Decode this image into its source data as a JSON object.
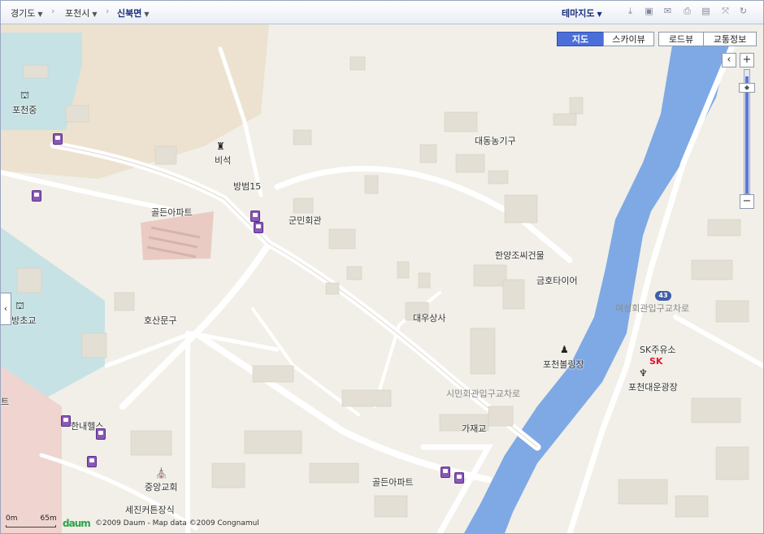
{
  "breadcrumb": [
    {
      "label": "경기도",
      "has_dropdown": true
    },
    {
      "label": "포천시",
      "has_dropdown": true
    },
    {
      "label": "신북면",
      "has_dropdown": true
    }
  ],
  "toolbar": {
    "theme_label": "테마지도",
    "icons": [
      "download-icon",
      "save-icon",
      "mail-icon",
      "print-icon",
      "ruler-icon",
      "fullscreen-icon",
      "refresh-icon"
    ]
  },
  "map_types": {
    "map": "지도",
    "skyview": "스카이뷰",
    "roadview": "로드뷰",
    "traffic": "교통정보",
    "active": "지도"
  },
  "zoom": {
    "plus": "+",
    "minus": "−",
    "back": "‹",
    "level_fraction": 0.95
  },
  "left_tab": "‹",
  "places": {
    "pocheon_middle": "포천중",
    "biseok": "비석",
    "bangbeom15": "방범15",
    "golden_apt1": "골든아파트",
    "gunmin_hall": "군민회관",
    "daedong": "대동농기구",
    "hanyang": "한양조씨건물",
    "geumho": "금호타이어",
    "daewoo": "대우상사",
    "hosan": "호산문구",
    "wangbang": "왕방초교",
    "pocheon_bowling": "포천볼링장",
    "sk_station": "SK주유소",
    "daeun_plaza": "포천대운광장",
    "gajae": "가재교",
    "golden_apt2": "골든아파트",
    "jungang_church": "중앙교회",
    "sejin": "세진커튼장식",
    "hanne": "한내헬스",
    "left_cut": "트"
  },
  "roads": {
    "simin_intersection": "시민회관입구교차로",
    "yeoseong_intersection": "여성회관입구교차로",
    "route_number": "43"
  },
  "sk_logo": "SK",
  "scale": {
    "start": "0m",
    "end": "65m"
  },
  "logo_text": "daum",
  "copyright": "©2009 Daum - Map data ©2009 Congnamul",
  "colors": {
    "river": "#7fa9e5",
    "building": "#e3dfd5",
    "road": "#ffffff",
    "apt": "#eacbc3",
    "school": "#bfe0e0",
    "accent": "#4a6fd8"
  }
}
